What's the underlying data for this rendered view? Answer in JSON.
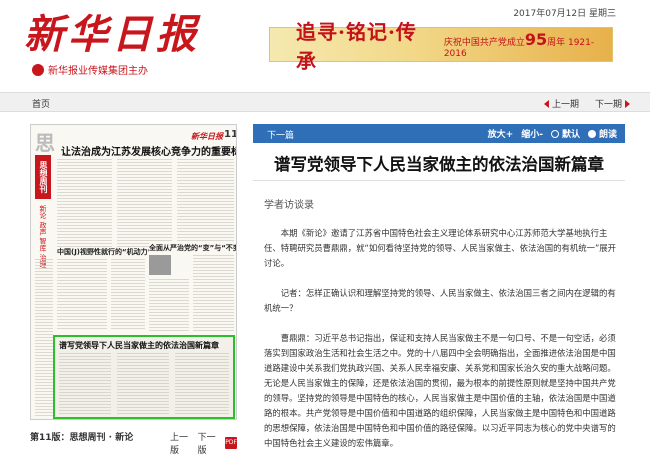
{
  "header": {
    "logo": "新华日报",
    "publisher": "新华报业传媒集团主办",
    "date": "2017年07月12日 星期三",
    "banner": {
      "main": "追寻·铭记·传承",
      "sub_prefix": "庆祝中国共产党成立",
      "sub_num": "95",
      "sub_suffix": "周年 1921-2016"
    }
  },
  "nav": {
    "home": "首页",
    "prev": "上一期",
    "next": "下一期"
  },
  "paper_thumbnail": {
    "page_char": "思",
    "logo": "新华日报",
    "page_num": "11",
    "main_headline": "让法治成为江苏发展核心竞争力的重要标志",
    "section_band": "思想周刊",
    "section_tags": "新论 政声 智库 治理",
    "headline_2": "中国(J)视野性就行的“机动力”",
    "headline_3": "全面从严治党的“变”与“不变”",
    "highlighted_headline": "谱写党领导下人民当家做主的依法治国新篇章"
  },
  "footer": {
    "issue": "第11版：思想周刊 · 新论",
    "prev_page": "上一版",
    "next_page": "下一版",
    "pdf": "PDF"
  },
  "article_toolbar": {
    "next_article": "下一篇",
    "zoom_in": "放大+",
    "zoom_out": "缩小-",
    "default": "默认",
    "read": "朗读"
  },
  "article": {
    "title": "谱写党领导下人民当家做主的依法治国新篇章",
    "subtitle": "学者访谈录",
    "paragraphs": [
      "本期《新论》邀请了江苏省中国特色社会主义理论体系研究中心江苏师范大学基地执行主任、特聘研究员曹鼎鼎，就“如何看待坚持党的领导、人民当家做主、依法治国的有机统一”展开讨论。",
      "记者：怎样正确认识和理解坚持党的领导、人民当家做主、依法治国三者之间内在逻辑的有机统一？",
      "曹鼎鼎：习近平总书记指出，保证和支持人民当家做主不是一句口号、不是一句空话，必须落实到国家政治生活和社会生活之中。党的十八届四中全会明确指出，全面推进依法治国是中国道路建设中关系我们党执政兴国、关系人民幸福安康、关系党和国家长治久安的重大战略问题。无论是人民当家做主的保障，还是依法治国的贯彻，最为根本的前提性原则就是坚持中国共产党的领导。坚持党的领导是中国特色的核心，人民当家做主是中国价值的主轴，依法治国是中国道路的根本。共产党领导是中国价值和中国道路的组织保障，人民当家做主是中国特色和中国道路的思想保障，依法治国是中国特色和中国价值的路径保障。以习近平同志为核心的党中央谱写的中国特色社会主义建设的宏伟篇章。"
    ]
  }
}
